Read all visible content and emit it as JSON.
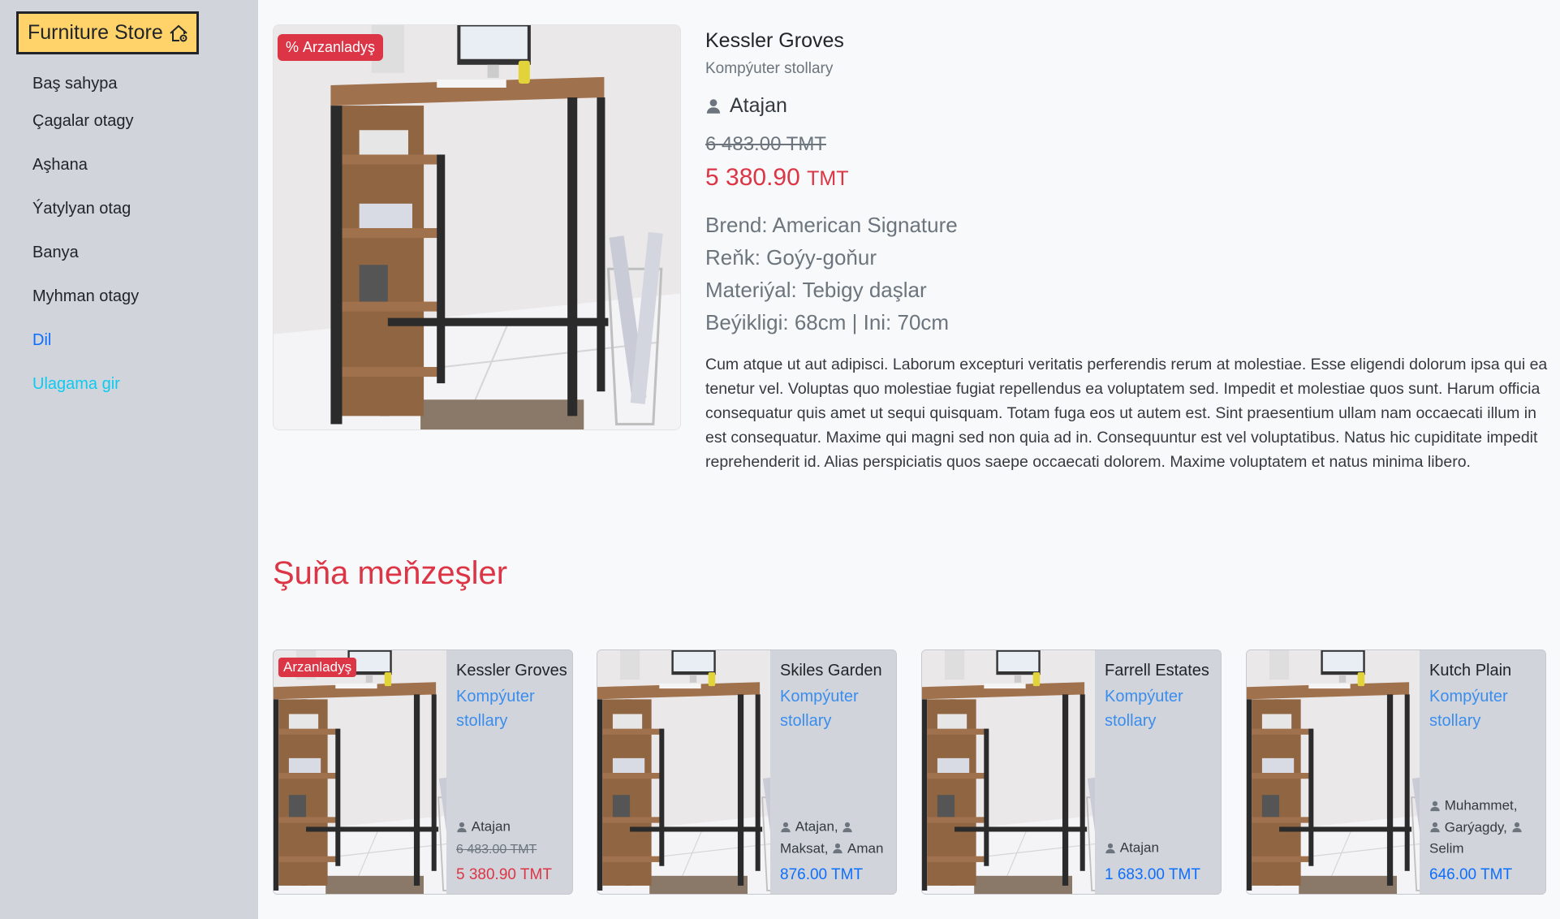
{
  "sidebar": {
    "brand": "Furniture Store",
    "items": [
      {
        "label": "Baş sahypa"
      },
      {
        "label": "Çagalar otagy"
      },
      {
        "label": "Aşhana"
      },
      {
        "label": "Ýatylyan otag"
      },
      {
        "label": "Banya"
      },
      {
        "label": "Myhman otagy"
      },
      {
        "label": "Dil"
      },
      {
        "label": "Ulagama gir"
      }
    ]
  },
  "product": {
    "sale_badge": "Arzanladyş",
    "title": "Kessler Groves",
    "category": "Kompýuter stollary",
    "author": "Atajan",
    "old_price": "6 483.00 TMT",
    "price": "5 380.90",
    "currency": "TMT",
    "brand": "Brend: American Signature",
    "color": "Reňk: Goýy-goňur",
    "material": "Materiýal: Tebigy daşlar",
    "size": "Beýikligi: 68cm | Ini: 70cm",
    "description": "Cum atque ut aut adipisci. Laborum excepturi veritatis perferendis rerum at molestiae. Esse eligendi dolorum ipsa qui ea tenetur vel. Voluptas quo molestiae fugiat repellendus ea voluptatem sed. Impedit et molestiae quos sunt. Harum officia consequatur quis amet ut sequi quisquam. Totam fuga eos ut autem est. Sint praesentium ullam nam occaecati illum in est consequatur. Maxime qui magni sed non quia ad in. Consequuntur est vel voluptatibus. Natus hic cupiditate impedit reprehenderit id. Alias perspiciatis quos saepe occaecati dolorem. Maxime voluptatem et natus minima libero."
  },
  "similar": {
    "heading": "Şuňa meňzeşler",
    "cards": [
      {
        "sale_badge": "Arzanladyş",
        "title": "Kessler Groves",
        "category": "Kompýuter stollary",
        "author_1": "Atajan",
        "old_price": "6 483.00 TMT",
        "price": "5 380.90 TMT"
      },
      {
        "title": "Skiles Garden",
        "category": "Kompýuter stollary",
        "author_1": "Atajan,",
        "author_2": "Maksat,",
        "author_3": "Aman",
        "price": "876.00 TMT"
      },
      {
        "title": "Farrell Estates",
        "category": "Kompýuter stollary",
        "author_1": "Atajan",
        "price": "1 683.00 TMT"
      },
      {
        "title": "Kutch Plain",
        "category": "Kompýuter stollary",
        "author_1": "Muhammet,",
        "author_2": "Garýagdy,",
        "author_3": "Selim",
        "price": "646.00 TMT"
      }
    ]
  },
  "colors": {
    "accent_red": "#dc3545",
    "link_blue": "#0d6efd",
    "link_cyan": "#0dcaf0",
    "brand_yellow": "#ffd36a",
    "sidebar_bg": "#d1d5db"
  },
  "icons": [
    "house-gear-icon",
    "person-icon",
    "percent-icon"
  ]
}
